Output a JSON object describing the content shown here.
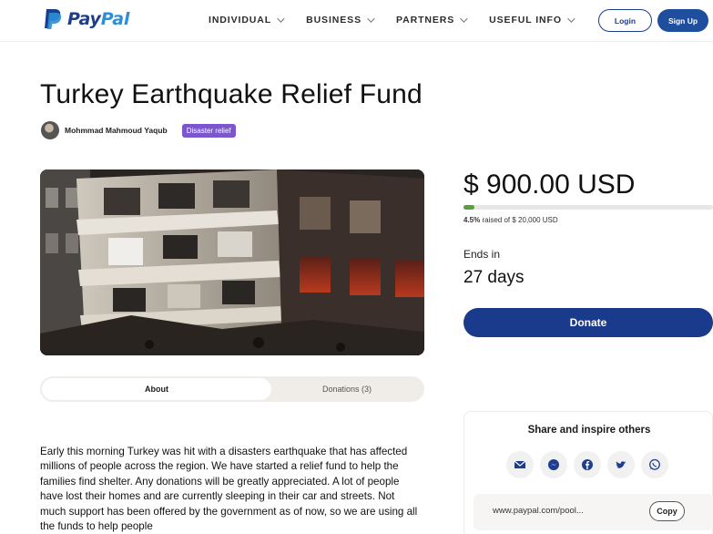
{
  "header": {
    "brand_pay": "Pay",
    "brand_pal": "Pal",
    "nav": [
      {
        "label": "INDIVIDUAL"
      },
      {
        "label": "BUSINESS"
      },
      {
        "label": "PARTNERS"
      },
      {
        "label": "USEFUL INFO"
      }
    ],
    "login_label": "Login",
    "signup_label": "Sign Up"
  },
  "campaign": {
    "title": "Turkey Earthquake Relief Fund",
    "organizer": "Mohmmad Mahmoud Yaqub",
    "tag": "Disaster relief"
  },
  "tabs": {
    "about": "About",
    "donations": "Donations (3)"
  },
  "story": "Early this morning Turkey was hit with a disasters earthquake that has affected millions of people across the region. We have started a relief fund to help the families find shelter. Any donations will be greatly appreciated. A lot of people have lost their homes and are currently sleeping in their car and streets. Not much support has been offered by the government as of now, so we are using all the funds to help people",
  "funding": {
    "amount": "$ 900.00 USD",
    "percent": "4.5%",
    "percent_value": 0.045,
    "raised_text": "raised of $ 20,000 USD",
    "ends_label": "Ends in",
    "days_left": "27 days",
    "donate_label": "Donate"
  },
  "share": {
    "title": "Share and inspire others",
    "icons": [
      "email-icon",
      "messenger-icon",
      "facebook-icon",
      "twitter-icon",
      "whatsapp-icon"
    ],
    "link": "www.paypal.com/pool...",
    "copy_label": "Copy"
  },
  "colors": {
    "brand_dark": "#1d3d8f",
    "brand_light": "#2a8fd6",
    "donate": "#1a3a8c",
    "tag": "#7a56cf",
    "progress": "#5aa03a"
  }
}
